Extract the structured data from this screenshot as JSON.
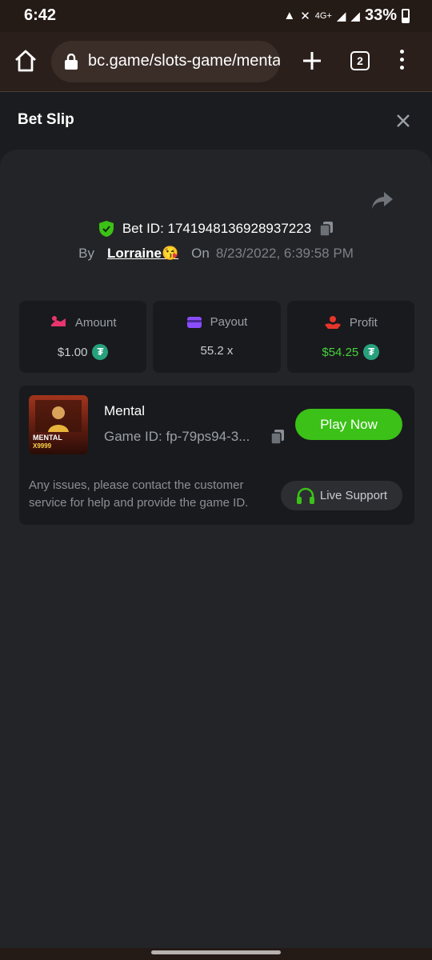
{
  "status_bar": {
    "time": "6:42",
    "network": "4G+",
    "battery": "33%"
  },
  "browser": {
    "url": "bc.game/slots-game/menta",
    "tab_count": "2"
  },
  "sheet": {
    "title": "Bet Slip"
  },
  "bet": {
    "bet_id_text": "Bet ID: 1741948136928937223",
    "by_label": "By",
    "username": "Lorraine😘",
    "on_label": "On",
    "datetime": "8/23/2022, 6:39:58 PM"
  },
  "stats": [
    {
      "label": "Amount",
      "value": "$1.00",
      "icon": "amount-icon",
      "color": "#e8356d"
    },
    {
      "label": "Payout",
      "value": "55.2 x",
      "icon": "payout-icon",
      "color": "#8a4dff"
    },
    {
      "label": "Profit",
      "value": "$54.25",
      "icon": "profit-icon",
      "color": "#e8352c"
    }
  ],
  "game": {
    "name": "Mental",
    "game_id": "Game ID: fp-79ps94-3...",
    "thumb_title": "MENTAL",
    "thumb_sub": "X9999",
    "play_label": "Play Now",
    "issue_text": "Any issues, please contact the customer service for help and provide the game ID.",
    "support_label": "Live Support"
  },
  "colors": {
    "accent_green": "#3bc117",
    "profit_green": "#45d13a",
    "usdt": "#26a17b"
  }
}
